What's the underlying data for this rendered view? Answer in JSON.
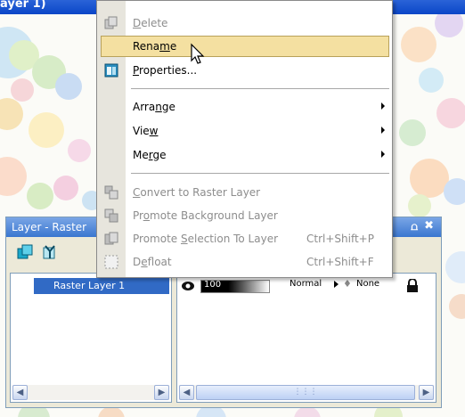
{
  "window": {
    "title": "ayer 1)"
  },
  "colors": {
    "title_bar": "#0a46c7",
    "menu_highlight": "#f4e0a1",
    "selection": "#316ac5"
  },
  "context_menu": {
    "items": [
      {
        "label": "Delete",
        "mnemonic_index": 0,
        "icon": "delete-layer-icon",
        "disabled": true
      },
      {
        "label": "Rename",
        "mnemonic_index": 4,
        "highlighted": true
      },
      {
        "label": "Properties...",
        "mnemonic_index": 0,
        "icon": "properties-icon"
      },
      {
        "label": "Arrange",
        "mnemonic_index": 4,
        "submenu": true
      },
      {
        "label": "View",
        "mnemonic_index": 3,
        "submenu": true
      },
      {
        "label": "Merge",
        "mnemonic_index": 2,
        "submenu": true
      },
      {
        "label": "Convert to Raster Layer",
        "mnemonic_index": 0,
        "icon": "convert-raster-icon",
        "disabled": true
      },
      {
        "label": "Promote Background Layer",
        "mnemonic_index": 2,
        "icon": "promote-background-icon",
        "disabled": true
      },
      {
        "label": "Promote Selection To Layer",
        "mnemonic_index": 8,
        "icon": "promote-selection-icon",
        "disabled": true,
        "shortcut": "Ctrl+Shift+P"
      },
      {
        "label": "Defloat",
        "mnemonic_index": 1,
        "icon": "defloat-icon",
        "disabled": true,
        "shortcut": "Ctrl+Shift+F"
      }
    ]
  },
  "layer_palette": {
    "title": "Layer - Raster",
    "pin_glyph": "⩍",
    "close_glyph": "✖",
    "layers": [
      {
        "name": "Raster Layer 1"
      }
    ],
    "properties": {
      "opacity": "100",
      "blend_mode": "Normal",
      "mask": "None",
      "opacity_level": 1.0
    }
  }
}
